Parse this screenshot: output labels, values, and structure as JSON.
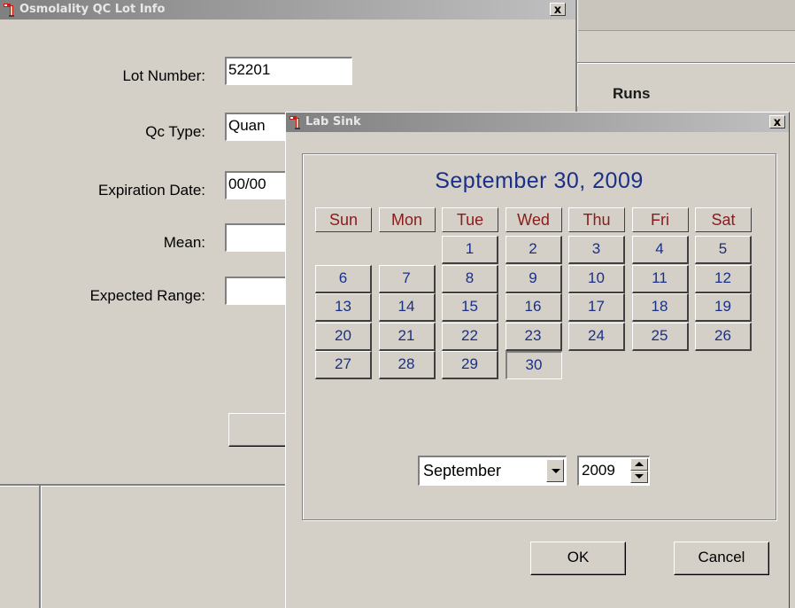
{
  "background": {
    "runs_label": "Runs"
  },
  "lot_dialog": {
    "title": "Osmolality QC Lot Info",
    "close_label": "x",
    "fields": {
      "lot_number": {
        "label": "Lot Number:",
        "value": "52201"
      },
      "qc_type": {
        "label": "Qc Type:",
        "value": "Quan"
      },
      "expiration_date": {
        "label": "Expiration Date:",
        "value": "00/00"
      },
      "mean": {
        "label": "Mean:",
        "value": ""
      },
      "expected_range": {
        "label": "Expected Range:",
        "value": ""
      }
    }
  },
  "lab_sink_dialog": {
    "title": "Lab Sink",
    "close_label": "x",
    "calendar": {
      "current_date": "September 30, 2009",
      "day_headers": [
        "Sun",
        "Mon",
        "Tue",
        "Wed",
        "Thu",
        "Fri",
        "Sat"
      ],
      "first_weekday_index": 2,
      "days_in_month": 30,
      "selected_day": 30,
      "days": [
        "1",
        "2",
        "3",
        "4",
        "5",
        "6",
        "7",
        "8",
        "9",
        "10",
        "11",
        "12",
        "13",
        "14",
        "15",
        "16",
        "17",
        "18",
        "19",
        "20",
        "21",
        "22",
        "23",
        "24",
        "25",
        "26",
        "27",
        "28",
        "29",
        "30"
      ]
    },
    "month_select": {
      "value": "September"
    },
    "year_spinner": {
      "value": "2009"
    },
    "ok_label": "OK",
    "cancel_label": "Cancel"
  },
  "colors": {
    "window_face": "#d4d0c8",
    "inactive_title_start": "#808080",
    "inactive_title_end": "#c0c0c0",
    "calendar_date_text": "#1a2f86",
    "day_header_text": "#8b1a1a"
  },
  "icons": {
    "app_icon": "magnet-icon",
    "close_icon": "close-icon",
    "dropdown_arrow": "chevron-down-icon",
    "spin_up": "spin-up-icon",
    "spin_down": "spin-down-icon"
  }
}
